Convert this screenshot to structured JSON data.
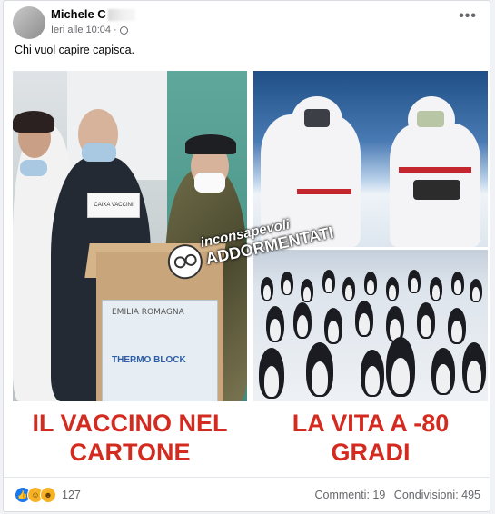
{
  "post": {
    "author": "Michele C",
    "timestamp": "Ieri alle 10:04",
    "separator": "·",
    "text": "Chi vuol capire capisca.",
    "more_label": "•••"
  },
  "image": {
    "left_panel": {
      "box_label": "EMILIA ROMAGNA",
      "cooler_label": "THERMO BLOCK",
      "vial_label": "CAIXA VACCINI"
    },
    "watermark_top": "inconsapevoli",
    "watermark_bottom": "ADDORMENTATI",
    "caption_left": "IL VACCINO NEL CARTONE",
    "caption_right": "LA VITA A -80 GRADI"
  },
  "footer": {
    "reaction_count": "127",
    "comments_label": "Commenti: 19",
    "shares_label": "Condivisioni: 495",
    "reactions": [
      "like-icon",
      "haha-icon",
      "wow-icon"
    ]
  },
  "colors": {
    "caption_red": "#d42b20",
    "like_blue": "#1877f2",
    "meta_gray": "#65676b"
  }
}
